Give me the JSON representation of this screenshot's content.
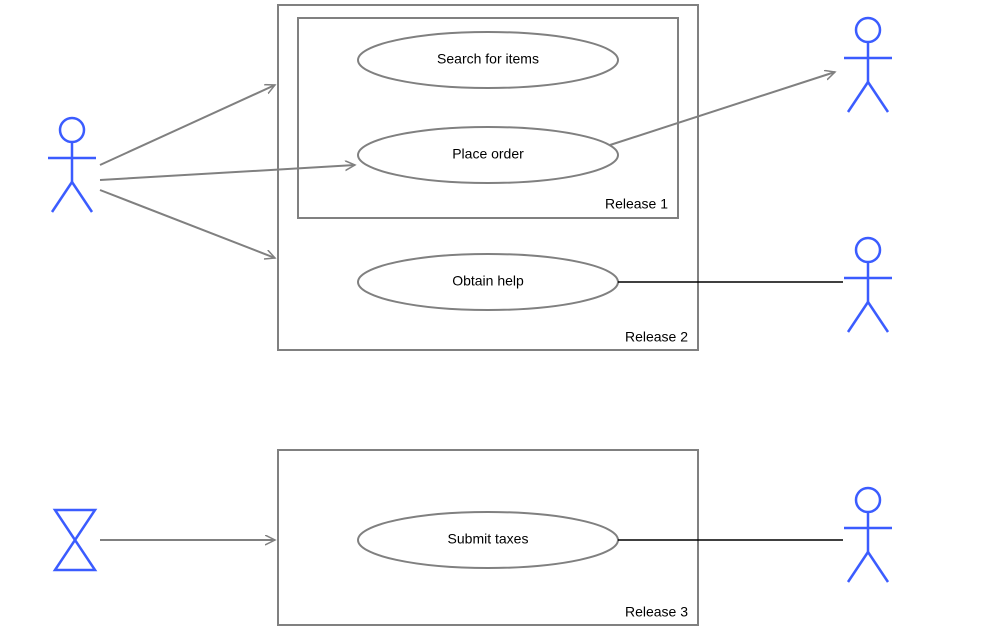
{
  "releases": {
    "r1": {
      "label": "Release 1"
    },
    "r2": {
      "label": "Release 2"
    },
    "r3": {
      "label": "Release 3"
    }
  },
  "usecases": {
    "search": {
      "label": "Search for items"
    },
    "place": {
      "label": "Place order"
    },
    "help": {
      "label": "Obtain help"
    },
    "taxes": {
      "label": "Submit taxes"
    }
  },
  "colors": {
    "actor": "#3b5cff",
    "box": "#808080",
    "arrow": "#808080",
    "line": "#000000"
  }
}
